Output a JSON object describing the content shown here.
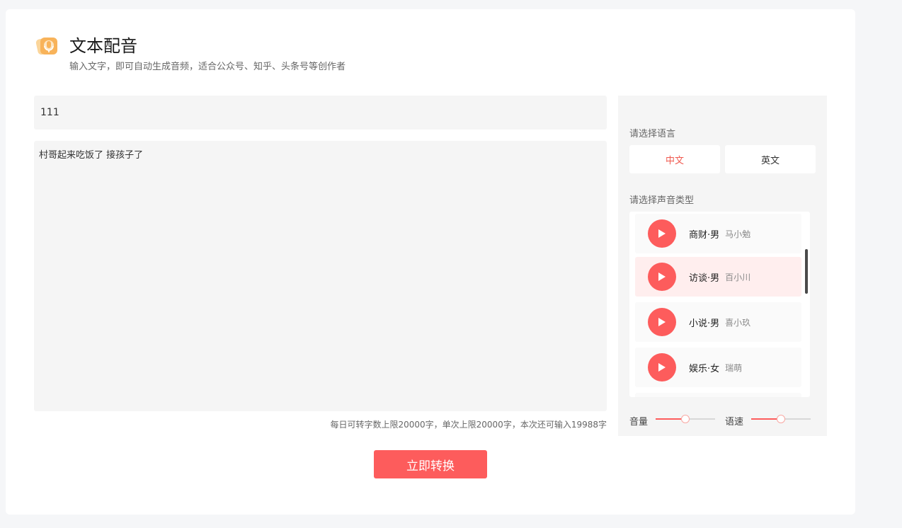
{
  "header": {
    "title": "文本配音",
    "subtitle": "输入文字，即可自动生成音频，适合公众号、知乎、头条号等创作者"
  },
  "editor": {
    "title_value": "111",
    "content_value": "村哥起来吃饭了 接孩子了",
    "limit_hint": "每日可转字数上限20000字，单次上限20000字，本次还可输入19988字"
  },
  "convert_label": "立即转换",
  "settings": {
    "language_label": "请选择语言",
    "languages": [
      {
        "label": "中文",
        "active": true
      },
      {
        "label": "英文",
        "active": false
      }
    ],
    "voice_label": "请选择声音类型",
    "voices": [
      {
        "name": "商财·男",
        "speaker": "马小勉",
        "selected": false
      },
      {
        "name": "访谈·男",
        "speaker": "百小川",
        "selected": true
      },
      {
        "name": "小说·男",
        "speaker": "喜小玖",
        "selected": false
      },
      {
        "name": "娱乐·女",
        "speaker": "瑞萌",
        "selected": false
      }
    ],
    "volume_label": "音量",
    "speed_label": "语速",
    "volume_level": 0.5,
    "speed_level": 0.5
  },
  "colors": {
    "accent": "#fd5c5c",
    "selected_bg": "#ffeeee",
    "active_lang_text": "#f0594f"
  }
}
